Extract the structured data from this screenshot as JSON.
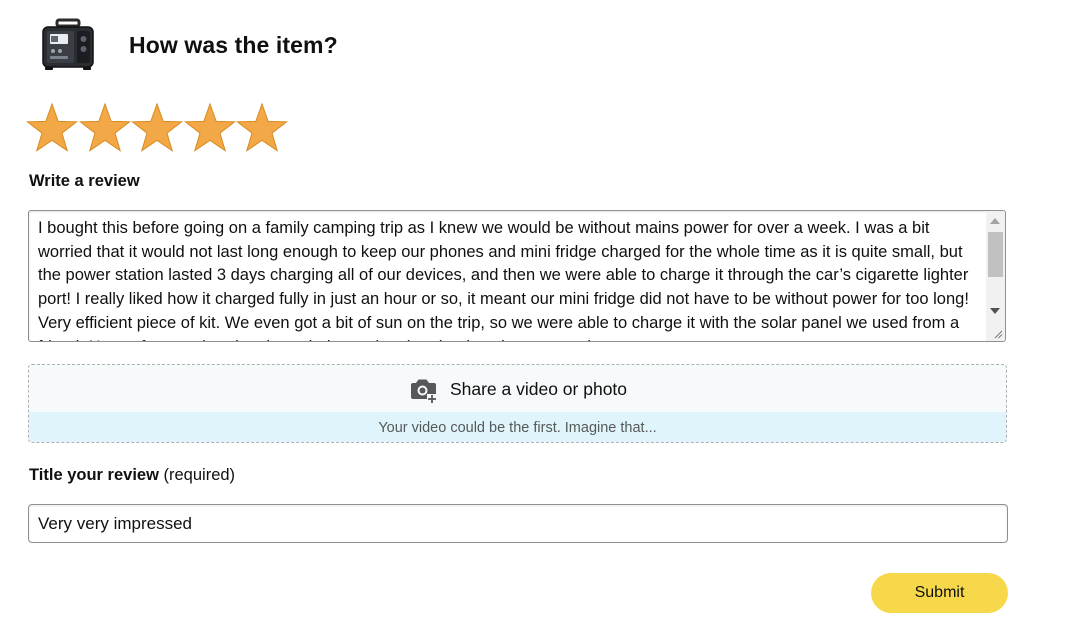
{
  "header": {
    "title": "How was the item?",
    "product_icon": "portable-power-station-icon"
  },
  "rating": {
    "value": 5,
    "max": 5,
    "star_color": "#f3a847",
    "icon": "star-icon"
  },
  "review": {
    "label": "Write a review",
    "text": "I bought this before going on a family camping trip as I knew we would be without mains power for over a week. I was a bit worried that it would not last long enough to keep our phones and mini fridge charged for the whole time as it is quite small, but the power station lasted 3 days charging all of our devices, and then we were able to charge it through the car’s cigarette lighter port! I really liked how it charged fully in just an hour or so, it meant our mini fridge did not have to be without power for too long! Very efficient piece of kit. We even got a bit of sun on the trip, so we were able to charge it with the solar panel we used from a friend. Not as fast as charging through the socket, but that is to be expected."
  },
  "media_upload": {
    "label": "Share a video or photo",
    "hint": "Your video could be the first. Imagine that...",
    "icon": "camera-add-icon"
  },
  "title_field": {
    "label": "Title your review",
    "label_suffix": "(required)",
    "value": "Very very impressed"
  },
  "submit": {
    "label": "Submit",
    "color": "#f7d84a"
  }
}
